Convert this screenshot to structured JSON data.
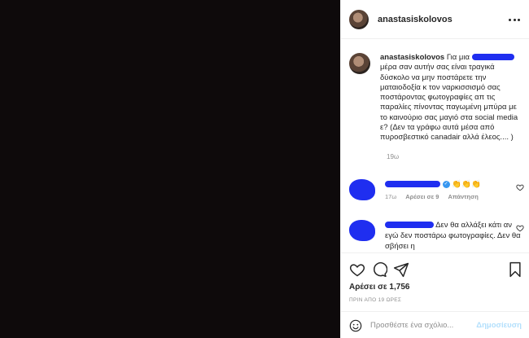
{
  "header": {
    "username": "anastasiskolovos"
  },
  "caption": {
    "username": "anastasiskolovos",
    "text_part1": "Για μια",
    "text_part2": "μέρα σαν αυτήν σας είναι τραγικά δύσκολο να μην ποστάρετε την ματαιοδοξία κ τον ναρκισσισμό σας ποστάροντας φωτογραφίες απ τις παραλίες πίνοντας παγωμένη μπύρα με το καινούριο σας μαγιό στα social media ε? (Δεν τα γράφω αυτά μέσα από πυροσβεστικό canadair αλλά έλεος.... )",
    "time": "19ω"
  },
  "comments": [
    {
      "emoji": "👏👏👏",
      "time": "17ω",
      "likes": "Αρέσει σε 9",
      "reply": "Απάντηση"
    },
    {
      "text": "Δεν θα αλλάξει κάτι αν εγώ δεν ποστάρω φωτογραφίες. Δεν θα σβήσει η"
    }
  ],
  "actions": {
    "likes": "Αρέσει σε 1,756",
    "date": "ΠΡΙΝ ΑΠΟ 19 ΩΡΕΣ",
    "comment_placeholder": "Προσθέστε ένα σχόλιο...",
    "post_label": "Δημοσίευση"
  },
  "colors": {
    "media_bg": "#0e0a0b",
    "scribble": "#1f2ef0",
    "link": "#b2dffc"
  },
  "icons": [
    "more-icon",
    "heart-icon",
    "comment-icon",
    "share-icon",
    "bookmark-icon",
    "smiley-icon",
    "verified-icon"
  ]
}
